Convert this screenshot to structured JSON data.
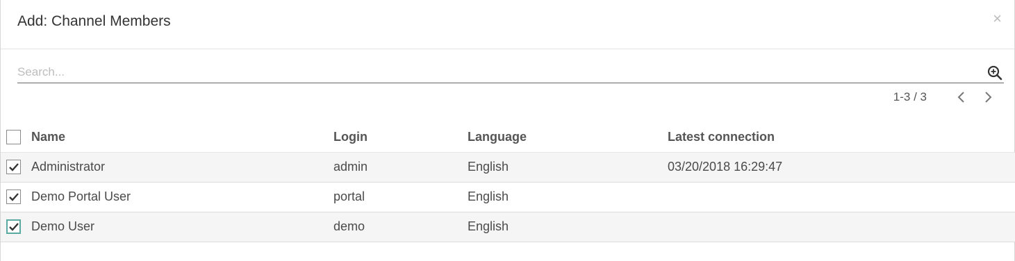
{
  "dialog": {
    "title": "Add: Channel Members",
    "close_label": "×"
  },
  "search": {
    "placeholder": "Search...",
    "value": "",
    "icon": "search-plus-icon"
  },
  "pager": {
    "value": "1-3 / 3",
    "prev_icon": "chevron-left-icon",
    "next_icon": "chevron-right-icon"
  },
  "table": {
    "columns": [
      "Name",
      "Login",
      "Language",
      "Latest connection"
    ],
    "select_all_checked": false,
    "rows": [
      {
        "checked": true,
        "name": "Administrator",
        "login": "admin",
        "language": "English",
        "latest_connection": "03/20/2018 16:29:47"
      },
      {
        "checked": true,
        "name": "Demo Portal User",
        "login": "portal",
        "language": "English",
        "latest_connection": ""
      },
      {
        "checked": true,
        "name": "Demo User",
        "login": "demo",
        "language": "English",
        "latest_connection": ""
      }
    ]
  }
}
